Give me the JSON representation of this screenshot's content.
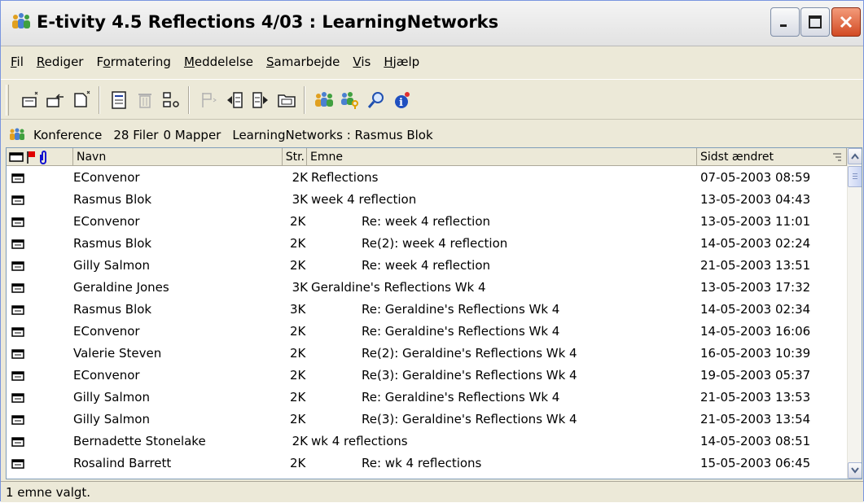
{
  "window": {
    "title": "E-tivity 4.5 Reflections 4/03 : LearningNetworks"
  },
  "menu": [
    {
      "pre": "",
      "u": "F",
      "post": "il"
    },
    {
      "pre": "",
      "u": "R",
      "post": "ediger"
    },
    {
      "pre": "F",
      "u": "o",
      "post": "rmatering"
    },
    {
      "pre": "",
      "u": "M",
      "post": "eddelelse"
    },
    {
      "pre": "",
      "u": "S",
      "post": "amarbejde"
    },
    {
      "pre": "",
      "u": "V",
      "post": "is"
    },
    {
      "pre": "",
      "u": "H",
      "post": "jælp"
    }
  ],
  "infobar": {
    "type": "Konference",
    "files": "28 Filer",
    "folders": "0 Mapper",
    "path": "LearningNetworks : Rasmus Blok"
  },
  "list": {
    "columns": {
      "name": "Navn",
      "size": "Str.",
      "subject": "Emne",
      "modified": "Sidst ændret"
    },
    "rows": [
      {
        "name": "EConvenor",
        "size": "2K",
        "subject": "Reflections",
        "level": 0,
        "date": "07-05-2003 08:59"
      },
      {
        "name": "Rasmus Blok",
        "size": "3K",
        "subject": "week 4 reflection",
        "level": 0,
        "date": "13-05-2003 04:43"
      },
      {
        "name": "EConvenor",
        "size": "2K",
        "subject": "Re: week 4 reflection",
        "level": 1,
        "date": "13-05-2003 11:01"
      },
      {
        "name": "Rasmus Blok",
        "size": "2K",
        "subject": "Re(2): week 4 reflection",
        "level": 1,
        "date": "14-05-2003 02:24"
      },
      {
        "name": "Gilly Salmon",
        "size": "2K",
        "subject": "Re: week 4 reflection",
        "level": 1,
        "date": "21-05-2003 13:51"
      },
      {
        "name": "Geraldine Jones",
        "size": "3K",
        "subject": "Geraldine's Reflections Wk 4",
        "level": 0,
        "date": "13-05-2003 17:32"
      },
      {
        "name": "Rasmus Blok",
        "size": "3K",
        "subject": "Re: Geraldine's Reflections Wk 4",
        "level": 1,
        "date": "14-05-2003 02:34"
      },
      {
        "name": "EConvenor",
        "size": "2K",
        "subject": "Re: Geraldine's Reflections Wk 4",
        "level": 1,
        "date": "14-05-2003 16:06"
      },
      {
        "name": "Valerie Steven",
        "size": "2K",
        "subject": "Re(2): Geraldine's Reflections Wk 4",
        "level": 1,
        "date": "16-05-2003 10:39"
      },
      {
        "name": "EConvenor",
        "size": "2K",
        "subject": "Re(3): Geraldine's Reflections Wk 4",
        "level": 1,
        "date": "19-05-2003 05:37"
      },
      {
        "name": "Gilly Salmon",
        "size": "2K",
        "subject": "Re: Geraldine's Reflections Wk 4",
        "level": 1,
        "date": "21-05-2003 13:53"
      },
      {
        "name": "Gilly Salmon",
        "size": "2K",
        "subject": "Re(3): Geraldine's Reflections Wk 4",
        "level": 1,
        "date": "21-05-2003 13:54"
      },
      {
        "name": "Bernadette Stonelake",
        "size": "2K",
        "subject": "wk 4 reflections",
        "level": 0,
        "date": "14-05-2003 08:51"
      },
      {
        "name": "Rosalind Barrett",
        "size": "2K",
        "subject": "Re: wk 4 reflections",
        "level": 1,
        "date": "15-05-2003 06:45"
      }
    ]
  },
  "status": "1 emne valgt.",
  "colors": {
    "close_button": "#d24a23",
    "flag": "#e00000",
    "attach": "#1010d0"
  }
}
